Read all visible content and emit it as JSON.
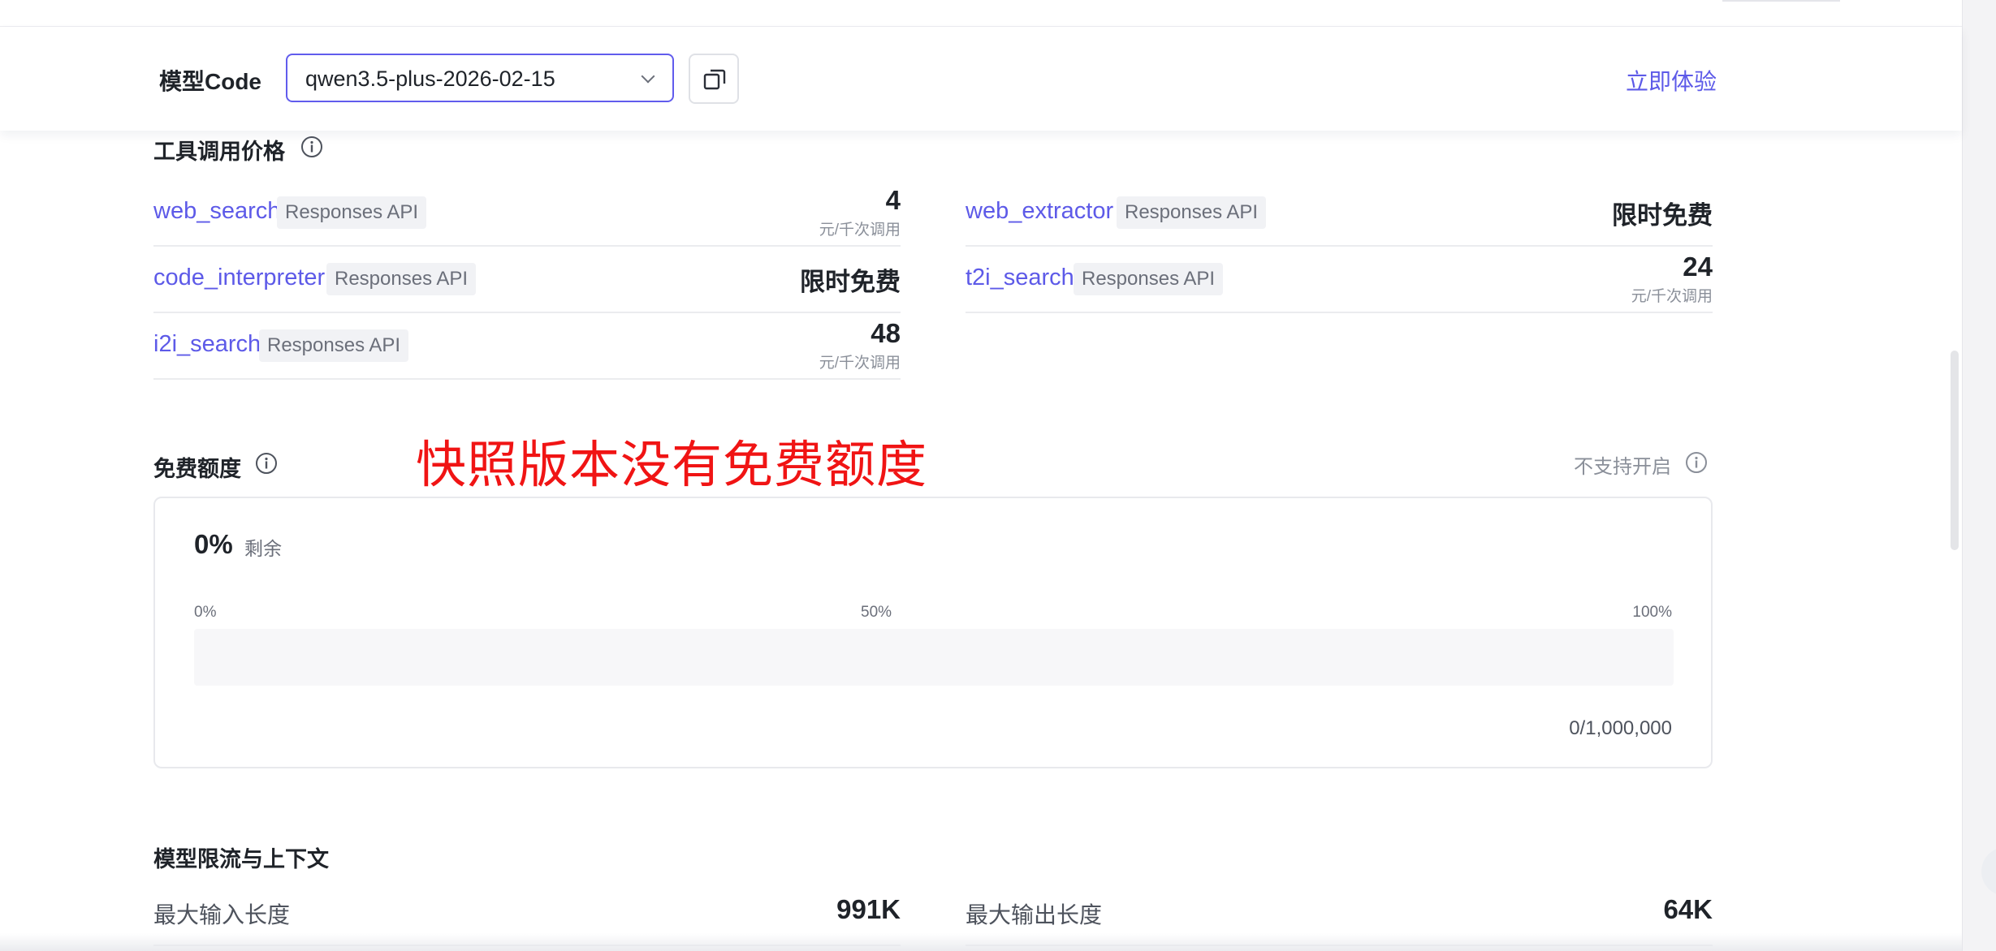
{
  "header": {
    "model_code_label": "模型Code",
    "model_select_value": "qwen3.5-plus-2026-02-15",
    "try_now": "立即体验"
  },
  "tool_pricing": {
    "title": "工具调用价格",
    "items": [
      {
        "name": "web_search",
        "badge": "Responses API",
        "price": "4",
        "unit": "元/千次调用"
      },
      {
        "name": "web_extractor",
        "badge": "Responses API",
        "price": "限时免费",
        "unit": ""
      },
      {
        "name": "code_interpreter",
        "badge": "Responses API",
        "price": "限时免费",
        "unit": ""
      },
      {
        "name": "t2i_search",
        "badge": "Responses API",
        "price": "24",
        "unit": "元/千次调用"
      },
      {
        "name": "i2i_search",
        "badge": "Responses API",
        "price": "48",
        "unit": "元/千次调用"
      }
    ]
  },
  "annotation": "快照版本没有免费额度",
  "free_quota": {
    "title": "免费额度",
    "unsupported_label": "不支持开启",
    "percent": "0%",
    "remaining_label": "剩余",
    "scale": [
      "0%",
      "50%",
      "100%"
    ],
    "fill_fraction": 0,
    "usage": "0/1,000,000"
  },
  "limits": {
    "title": "模型限流与上下文",
    "items": [
      {
        "label": "最大输入长度",
        "value": "991K"
      },
      {
        "label": "最大输出长度",
        "value": "64K"
      }
    ]
  },
  "colors": {
    "accent": "#5d5ae8",
    "annotation": "#f01414",
    "border": "#ebecef"
  }
}
